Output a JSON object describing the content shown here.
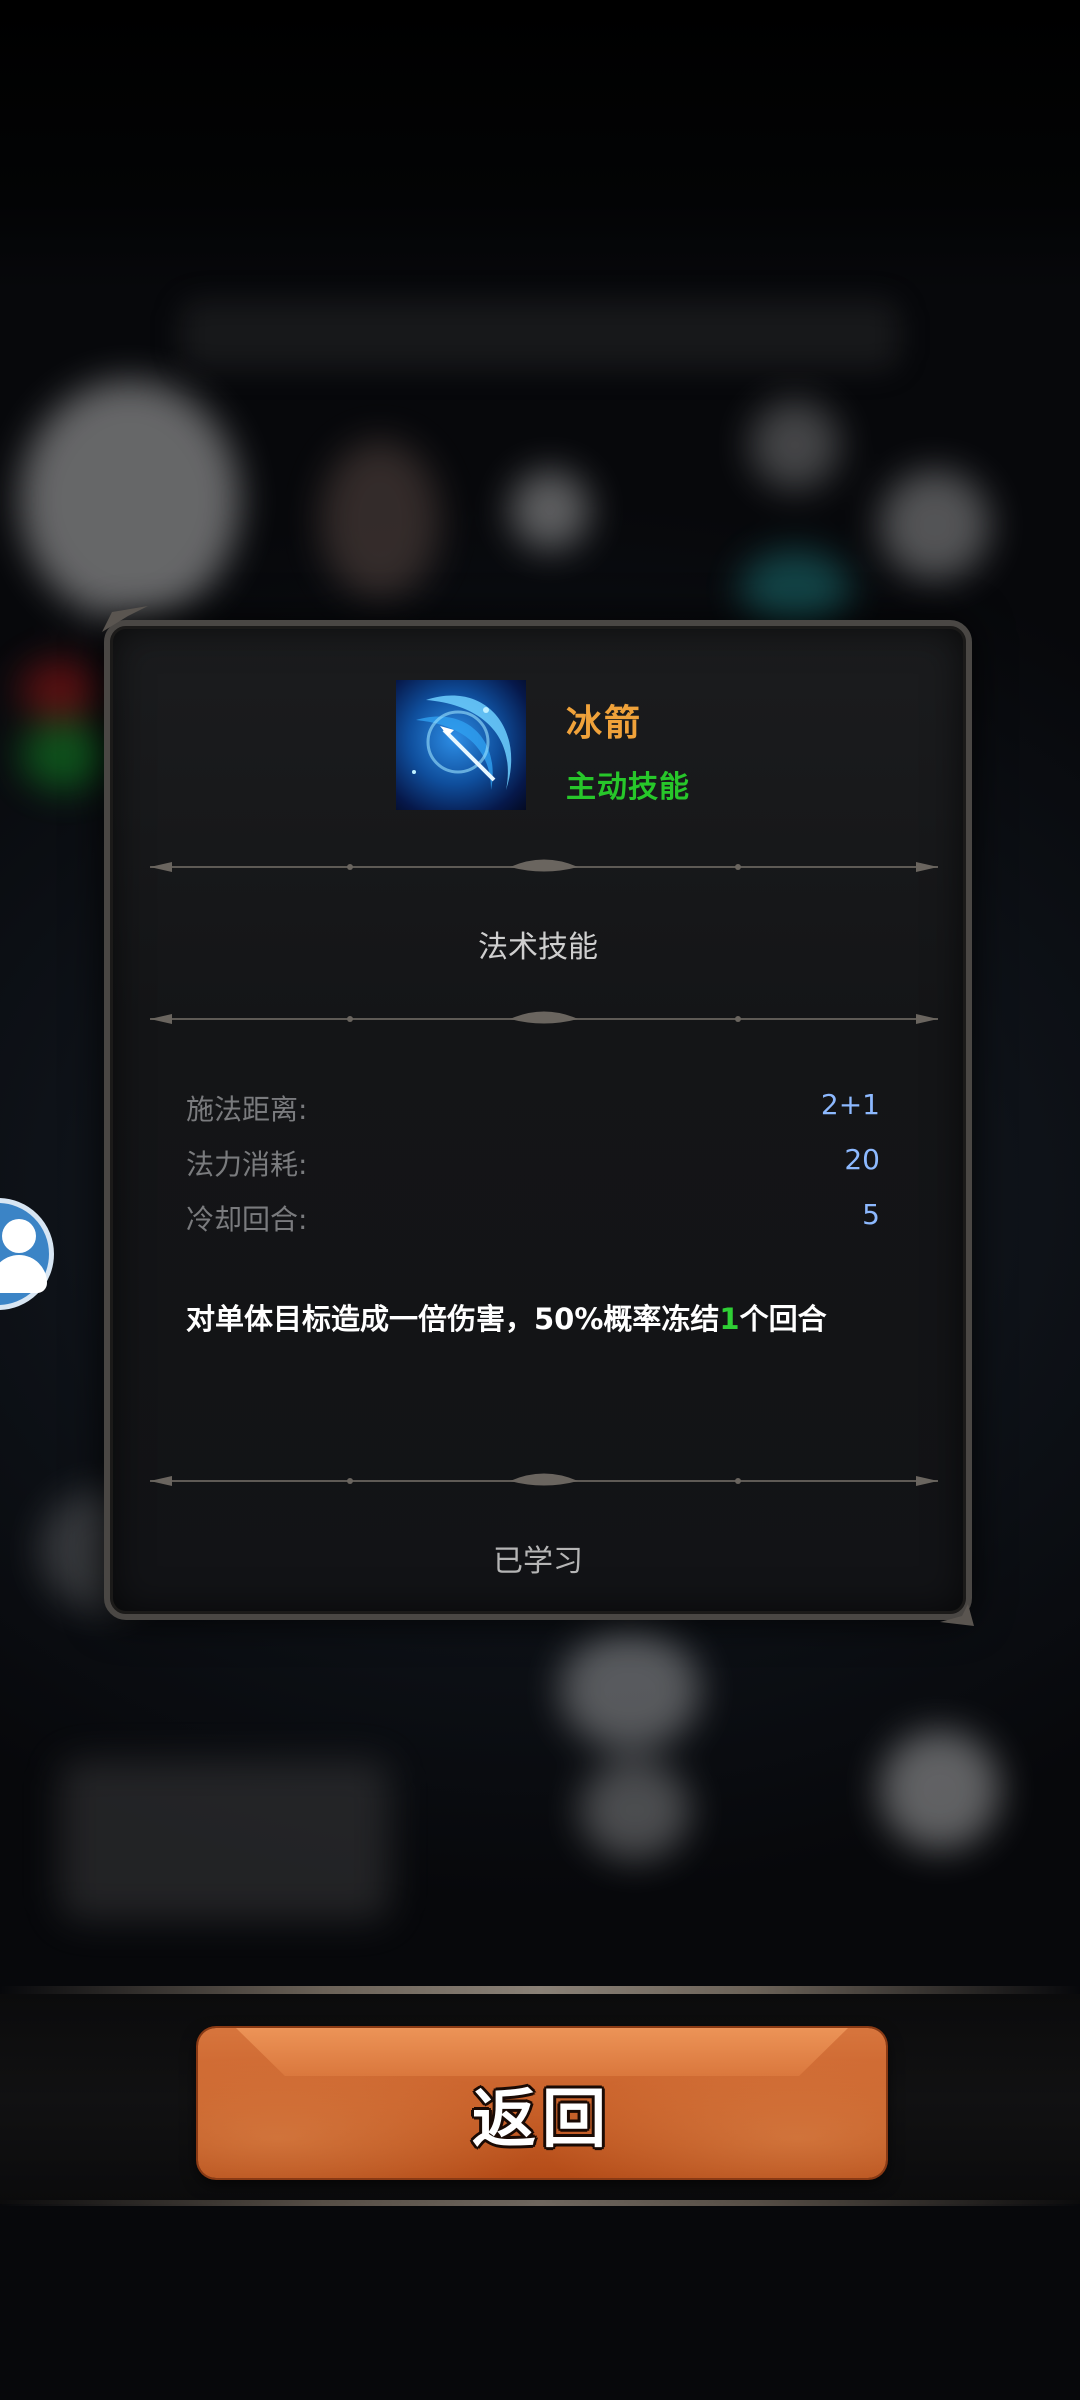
{
  "skill": {
    "name": "冰箭",
    "type": "主动技能",
    "category": "法术技能",
    "icon": "ice-arrow-skill-icon"
  },
  "stats": [
    {
      "label": "施法距离:",
      "value": "2+1"
    },
    {
      "label": "法力消耗:",
      "value": "20"
    },
    {
      "label": "冷却回合:",
      "value": "5"
    }
  ],
  "description": {
    "before": "对单体目标造成一倍伤害，50%概率冻结",
    "highlight": "1",
    "after": "个回合"
  },
  "status": "已学习",
  "back_button": {
    "label": "返回"
  },
  "colors": {
    "skill_name": "#f0a23a",
    "skill_type": "#27c72a",
    "stat_value": "#8db9ff",
    "highlight": "#2fcf35",
    "back_button": "#c75f28"
  }
}
